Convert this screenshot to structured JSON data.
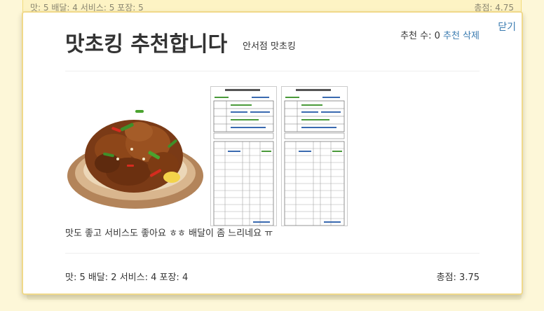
{
  "background_review": {
    "scores": "맛: 5 배달: 4 서비스: 5 포장: 5",
    "total": "총점: 4.75"
  },
  "modal": {
    "close_label": "닫기",
    "title": "맛초킹 추천합니다",
    "store_name": "안서점 맛초킹",
    "recommend_count_label": "추천 수: 0",
    "delete_recommend_label": "추천 삭제",
    "photos": [
      {
        "kind": "food-photo",
        "icon": "fried-chicken-image"
      },
      {
        "kind": "receipt",
        "icon": "receipt-image"
      },
      {
        "kind": "receipt",
        "icon": "receipt-image"
      }
    ],
    "review_text": "맛도 좋고 서비스도 좋아요 ㅎㅎ 배달이 좀 느리네요 ㅠ",
    "scores": "맛: 5 배달: 2 서비스: 4 포장: 4",
    "total": "총점: 3.75"
  },
  "colors": {
    "page_bg": "#fdf7d8",
    "card_border": "#f0d98a",
    "link": "#3a7bb0"
  }
}
